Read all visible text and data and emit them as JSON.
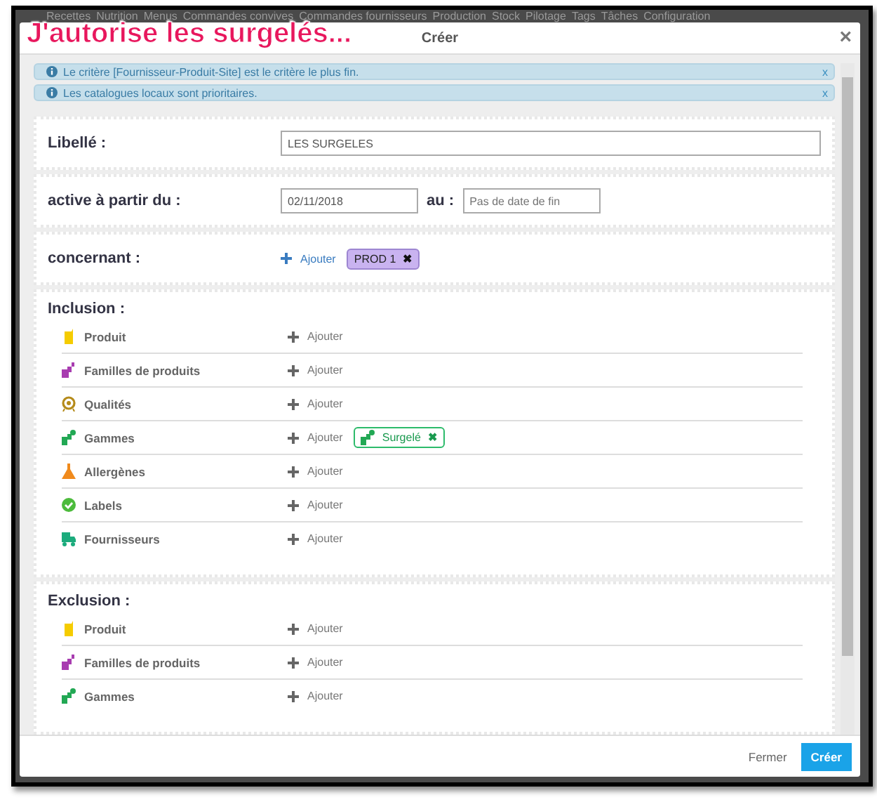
{
  "nav": [
    "Recettes",
    "Nutrition",
    "Menus",
    "Commandes convives",
    "Commandes fournisseurs",
    "Production",
    "Stock",
    "Pilotage",
    "Tags",
    "Tâches",
    "Configuration"
  ],
  "annotation": "J'autorise les surgelés...",
  "modal": {
    "title": "Créer",
    "close": "×"
  },
  "alerts": [
    {
      "text": "Le critère [Fournisseur-Produit-Site] est le critère le plus fin.",
      "close": "x"
    },
    {
      "text": "Les catalogues locaux sont prioritaires.",
      "close": "x"
    }
  ],
  "libelle": {
    "label": "Libellé :",
    "value": "LES SURGELES"
  },
  "dates": {
    "label": "active à partir du :",
    "start": "02/11/2018",
    "end_label": "au :",
    "end_placeholder": "Pas de date de fin"
  },
  "concernant": {
    "label": "concernant :",
    "add": "Ajouter",
    "tags": [
      {
        "text": "PROD 1",
        "remove": "✖"
      }
    ]
  },
  "inclusion": {
    "title": "Inclusion :",
    "rows": [
      {
        "kind": "product",
        "name": "Produit",
        "add": "Ajouter",
        "tags": []
      },
      {
        "kind": "family",
        "name": "Familles de produits",
        "add": "Ajouter",
        "tags": []
      },
      {
        "kind": "quality",
        "name": "Qualités",
        "add": "Ajouter",
        "tags": []
      },
      {
        "kind": "range",
        "name": "Gammes",
        "add": "Ajouter",
        "tags": [
          {
            "text": "Surgelé",
            "remove": "✖"
          }
        ]
      },
      {
        "kind": "allergen",
        "name": "Allergènes",
        "add": "Ajouter",
        "tags": []
      },
      {
        "kind": "label",
        "name": "Labels",
        "add": "Ajouter",
        "tags": []
      },
      {
        "kind": "supplier",
        "name": "Fournisseurs",
        "add": "Ajouter",
        "tags": []
      }
    ]
  },
  "exclusion": {
    "title": "Exclusion :",
    "rows": [
      {
        "kind": "product",
        "name": "Produit",
        "add": "Ajouter",
        "tags": []
      },
      {
        "kind": "family",
        "name": "Familles de produits",
        "add": "Ajouter",
        "tags": []
      },
      {
        "kind": "range",
        "name": "Gammes",
        "add": "Ajouter",
        "tags": []
      }
    ]
  },
  "footer": {
    "close": "Fermer",
    "create": "Créer"
  }
}
